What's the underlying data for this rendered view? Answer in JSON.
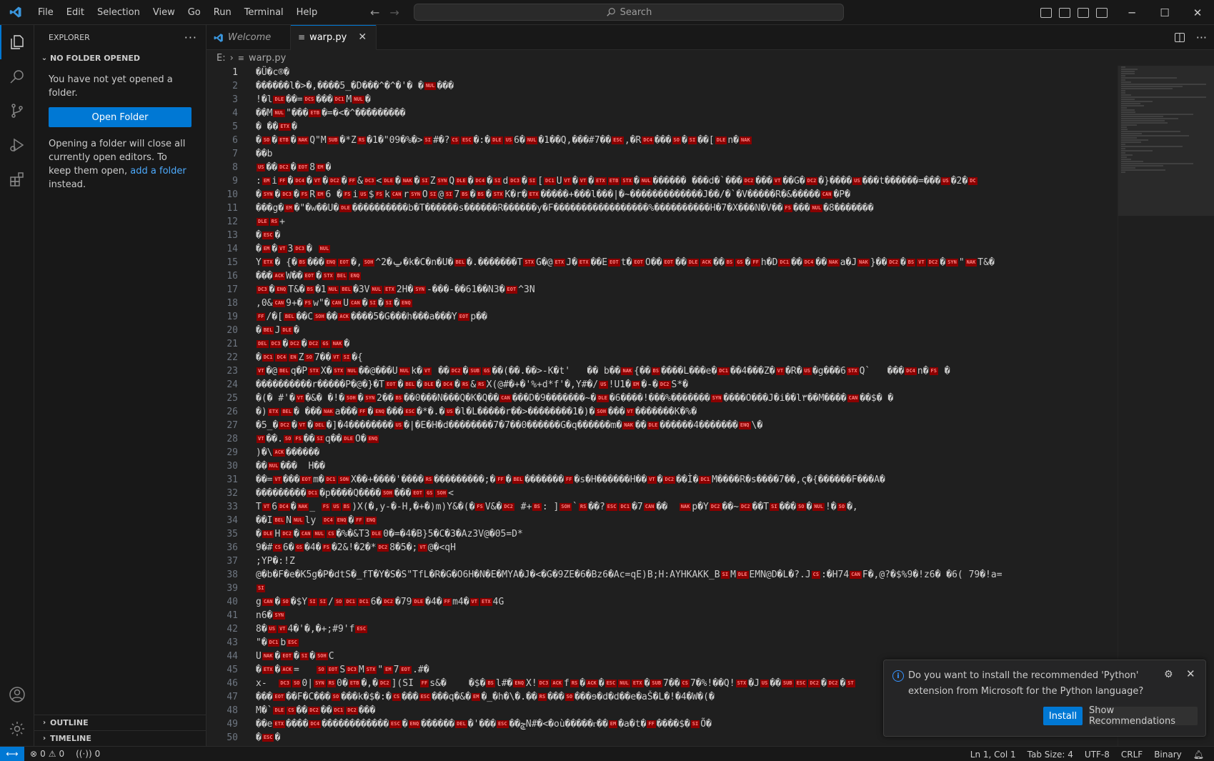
{
  "menu": [
    "File",
    "Edit",
    "Selection",
    "View",
    "Go",
    "Run",
    "Terminal",
    "Help"
  ],
  "search": {
    "placeholder": "Search"
  },
  "sidebar": {
    "title": "EXPLORER",
    "section": "NO FOLDER OPENED",
    "message": "You have not yet opened a folder.",
    "open_folder_label": "Open Folder",
    "info_before": "Opening a folder will close all currently open editors. To keep them open, ",
    "info_link": "add a folder",
    "info_after": " instead.",
    "outline": "OUTLINE",
    "timeline": "TIMELINE"
  },
  "tabs": [
    {
      "label": "Welcome",
      "active": false
    },
    {
      "label": "warp.py",
      "active": true
    }
  ],
  "breadcrumb": {
    "drive": "E:",
    "file": "warp.py"
  },
  "editor": {
    "lines": [
      "�Ü�c®�",
      "������l�>�,����5_�D���^�^�'� �[NUL]���",
      "!�l[DLE]��=[DCS]���[DC1]M[NUL]�",
      "��M[NUL]\"���[ETB]�=�<�^���������",
      "� ��[ETX]�",
      "�[SO]�[ETB]�[NAK]Q\"M[SUB]�*Z[RS]�1�\"09�%�>[SI]#�?[CS][ESC]�:�[DLE][US]6�[NUL]�1��Q,���#7��[ESC],�R[DC4]���[SO]�[SI]��[[DLE]n�[NAK]",
      "��b",
      "[US]��[DC2]�[EOT]8[EM]�",
      ":[EM]i[FF]�[DC4]�[VT]�[DC2]�[FF]&[DC3]<[DLE]�[NAK]�[SI]Z[SYN]Q[DLE]�[DC4]�[SI]d[DC3]�[SI][[DC1]U[VT]�[VT]�[ETX][ETB][STX]�[NUL]������ ���d�`���[DC2]���[VT]��G�[DC2]�}����[US]���t������=���[US]�2�[DC]",
      "�[SYN]�[DC3]�[FS]R[EM]6 �[FS]i[US]$[FS]k[CAN]r[SYN]O[SI]@[SI]7[BS]�[BS]�[STX]K�r�[ETX]�����+���l���|�~�������������J��/�`�V�����R�&�����[CAN]�P�",
      "���g�[EM]�\"�w��U�[DLE]����������b�T������s������R������y�F�����������������%����������H�7�X���N�V��[FS]���[NUL]�8�������",
      "[DLE][RS]+",
      "�[ESC]�",
      "�[EM]�[VT]3[DC3]� [NUL]",
      "Y[ETX]� {�[BS]���[ENQ][EOT]�,[SOH]^2�ݐ�k�C�n�U�[BEL]�.�������T[STX]G�@[ETX]J�[ETX]��E[EOT]t�[EOT]O��[EOT]��[DLE][ACK]��[BS][GS]�[FF]h�D[DC1]��[DC4]��[NAK]a�J[NAK]}��[DC2]�[BS][VT][DC2]�[SYN]\"[NAK]T&�",
      "���[ACK]W��[EOT]�[STX][BEL][ENQ]",
      "[DC3]�[ENQ]T&�[BS]�1[NUL][BEL]�3V[NUL][ETX]2H�[SYN]-���-��61��N3�[EOT]^3N",
      ",0&[CAN]9+�[FS]w\"�[CAN]U[CAN]�[SI]�[SI]�[ENQ]",
      "[FF]/�[[BEL]��C[SOH]��[ACK]����5�G���h���a���Y[EOT]p��",
      "�[BEL]J[DLE]�",
      "[DEL][DC3]�[DC2]�[DC2][GS][NAK]�",
      "�[DC1][DC4][EN]Z[SO]7��[VT][SI]�{",
      "[VT]�@[BEL]q�P[STX]X�[STX][NUL]��@���U[NUL]k�[VT] ��[DC2]�[SUB][GS]��(��.��>-K�t'   �� b��[NAK]{��[BS]����L���e�[DC1]��4���Z�[VT]�R�[US]�g���6[STX]Q`   ���[DC4]n�[FS] �",
      "����������r�����P�@�}�T[EOT]�[BEL]�[DLE]�[DC4]�[RS]&[RS]X(@#�+�'%+d*f'�,Y#�/[US]!U1�[EM]�-�[DC2]S*�",
      "�(� #'�[VT]�&� �!�[SOH]�[SYN]2��[BS]��0���N���Q�K�Q��[CAN]���D�9�������~�[DLE]�6����!���%�������[SYN]����O���J�i��l٣��M����[CAN]��$� �",
      "�)[ETX][BEL]� ���[NAK]a���[FF]�[ENQ]���[ESC]�*�.�[US]�l�L�����r��>��������1�)�[SOH]���[VT]�������K�%�",
      "�5̲�[DC2]�[VT]�[DEL]�]�4��������[US]�|�E�H�d��������7�7��0������G�q������m�[NAK]��[DLE]������4�������[ENQ]\\�",
      "[VT]��.[SO][FS]��[SI]q��[DLE]O�[ENQ]",
      ")�\\[ACK]������",
      "��[NUL]���  H��",
      "��=[VT]���[EOT]m�[DC1][SON]X��+����'����[RS]���������;�[FF]�[BEL]�������[FF]�s�H������H��[VT]�[DC2]��Ì�[DC1]M����R�s����7��,ς�{������F���A�",
      "���������[DC1]�p����Q����[SOH]���[EOT][GS][SOH]<",
      "T[VT]6[DC4]�[NAK]_ [FS][US][BS])X(�,y-�-H,�+�)m)Y&�(�[FS]V&�[DC2] #+[BS]: ][SOH]`[RS]��?[ESC][DC1]�7[CAN]��  [NAK]p�Y[DC2]��~[DC2]��T[SI]���[SO]�[NUL]!�[SO]�,",
      "��I[BEL]N[NUL]ly [DC4][ENQ]�[FF][ENQ]",
      "�[DLE]H[DC2]�[CAN][NUL][CS]�%�&T3[DLE]0�=�4�B}5�C�3�Az3V@�05=D*",
      "9�#[CS]6�[GS]�4�[FS]�2&!�2�*[DC2]8�5�;[VT]@�<qH",
      ";YP�:!Z",
      "@�b�F�e�K5g�P�dtS�_fT�Y�S�S\"TfL�R�G�O6H�N�E�MYA�J�<�G�9ZE�6�Bz6�Ac=qE)B;H:AYHKAKK_B[SI]M[DLE]EMN@D�L�?.J[CS]:�H74[CAN]F�,@?�$%9�!z6� �6( 79�!a=",
      "[SI]",
      "g[CAN]�[SO]�$Y[SI][SI]/[SO][DC1][DC1]6�[DC2]�79[DLE]�4�[FF]m4�[VT][ETX]4G",
      "n6�[SYN]",
      "8�[US][VT]4�'�,�+;#9'f[ESC]",
      "\"�[DC1]b[ESC]",
      "U[NAK]�[EOT]�[SI]�[SOH]C",
      "�[ETX]�[ACK]=   [SO][EOT]S[DC3]M[STX]\"[EM]7[EOT].#�",
      "x-  [DC3][SO]0|[SYN][RS]0�[ETB]�,�[DC2]](SI [FF]s&�    �$�[BS]l#�[ENQ]X![DC3][ACK]f[RS]�[ACK]�[ESC][NUL][ETX]�[SUB]7��[CS]7�%!��Q![STX]�J[US]��[SUB][ESC][DC2]�[DC2]�[ST]",
      "���[EOT]��F�C���[SO]���k�$�:�[CS]���[ESC]���q�&�[EM]�_�h�\\�.��[RS]���[SO]���ɘ�d�d��e�aŠ�L�!�4�W�(�",
      "M�`[DLE][CS]��[DC2]��[DC1][DC2]���",
      "��e[ETX]����[DC4]������������[ESC]�[ENQ]������[DEL]�'���[ESC]��ݘN#�<�où�����ᴦ��[EM]�a�t�[FF]����$�[SI]Õ�",
      "�[ESC]�"
    ]
  },
  "notification": {
    "message": "Do you want to install the recommended 'Python' extension from Microsoft for the Python language?",
    "install_label": "Install",
    "recommend_label": "Show Recommendations"
  },
  "statusbar": {
    "errors": "0",
    "warnings": "0",
    "ports": "0",
    "position": "Ln 1, Col 1",
    "tab_size": "Tab Size: 4",
    "encoding": "UTF-8",
    "eol": "CRLF",
    "language": "Binary"
  },
  "colors": {
    "accent": "#0078d4",
    "control_char_bg": "#8b0000",
    "background": "#1f1f1f"
  }
}
